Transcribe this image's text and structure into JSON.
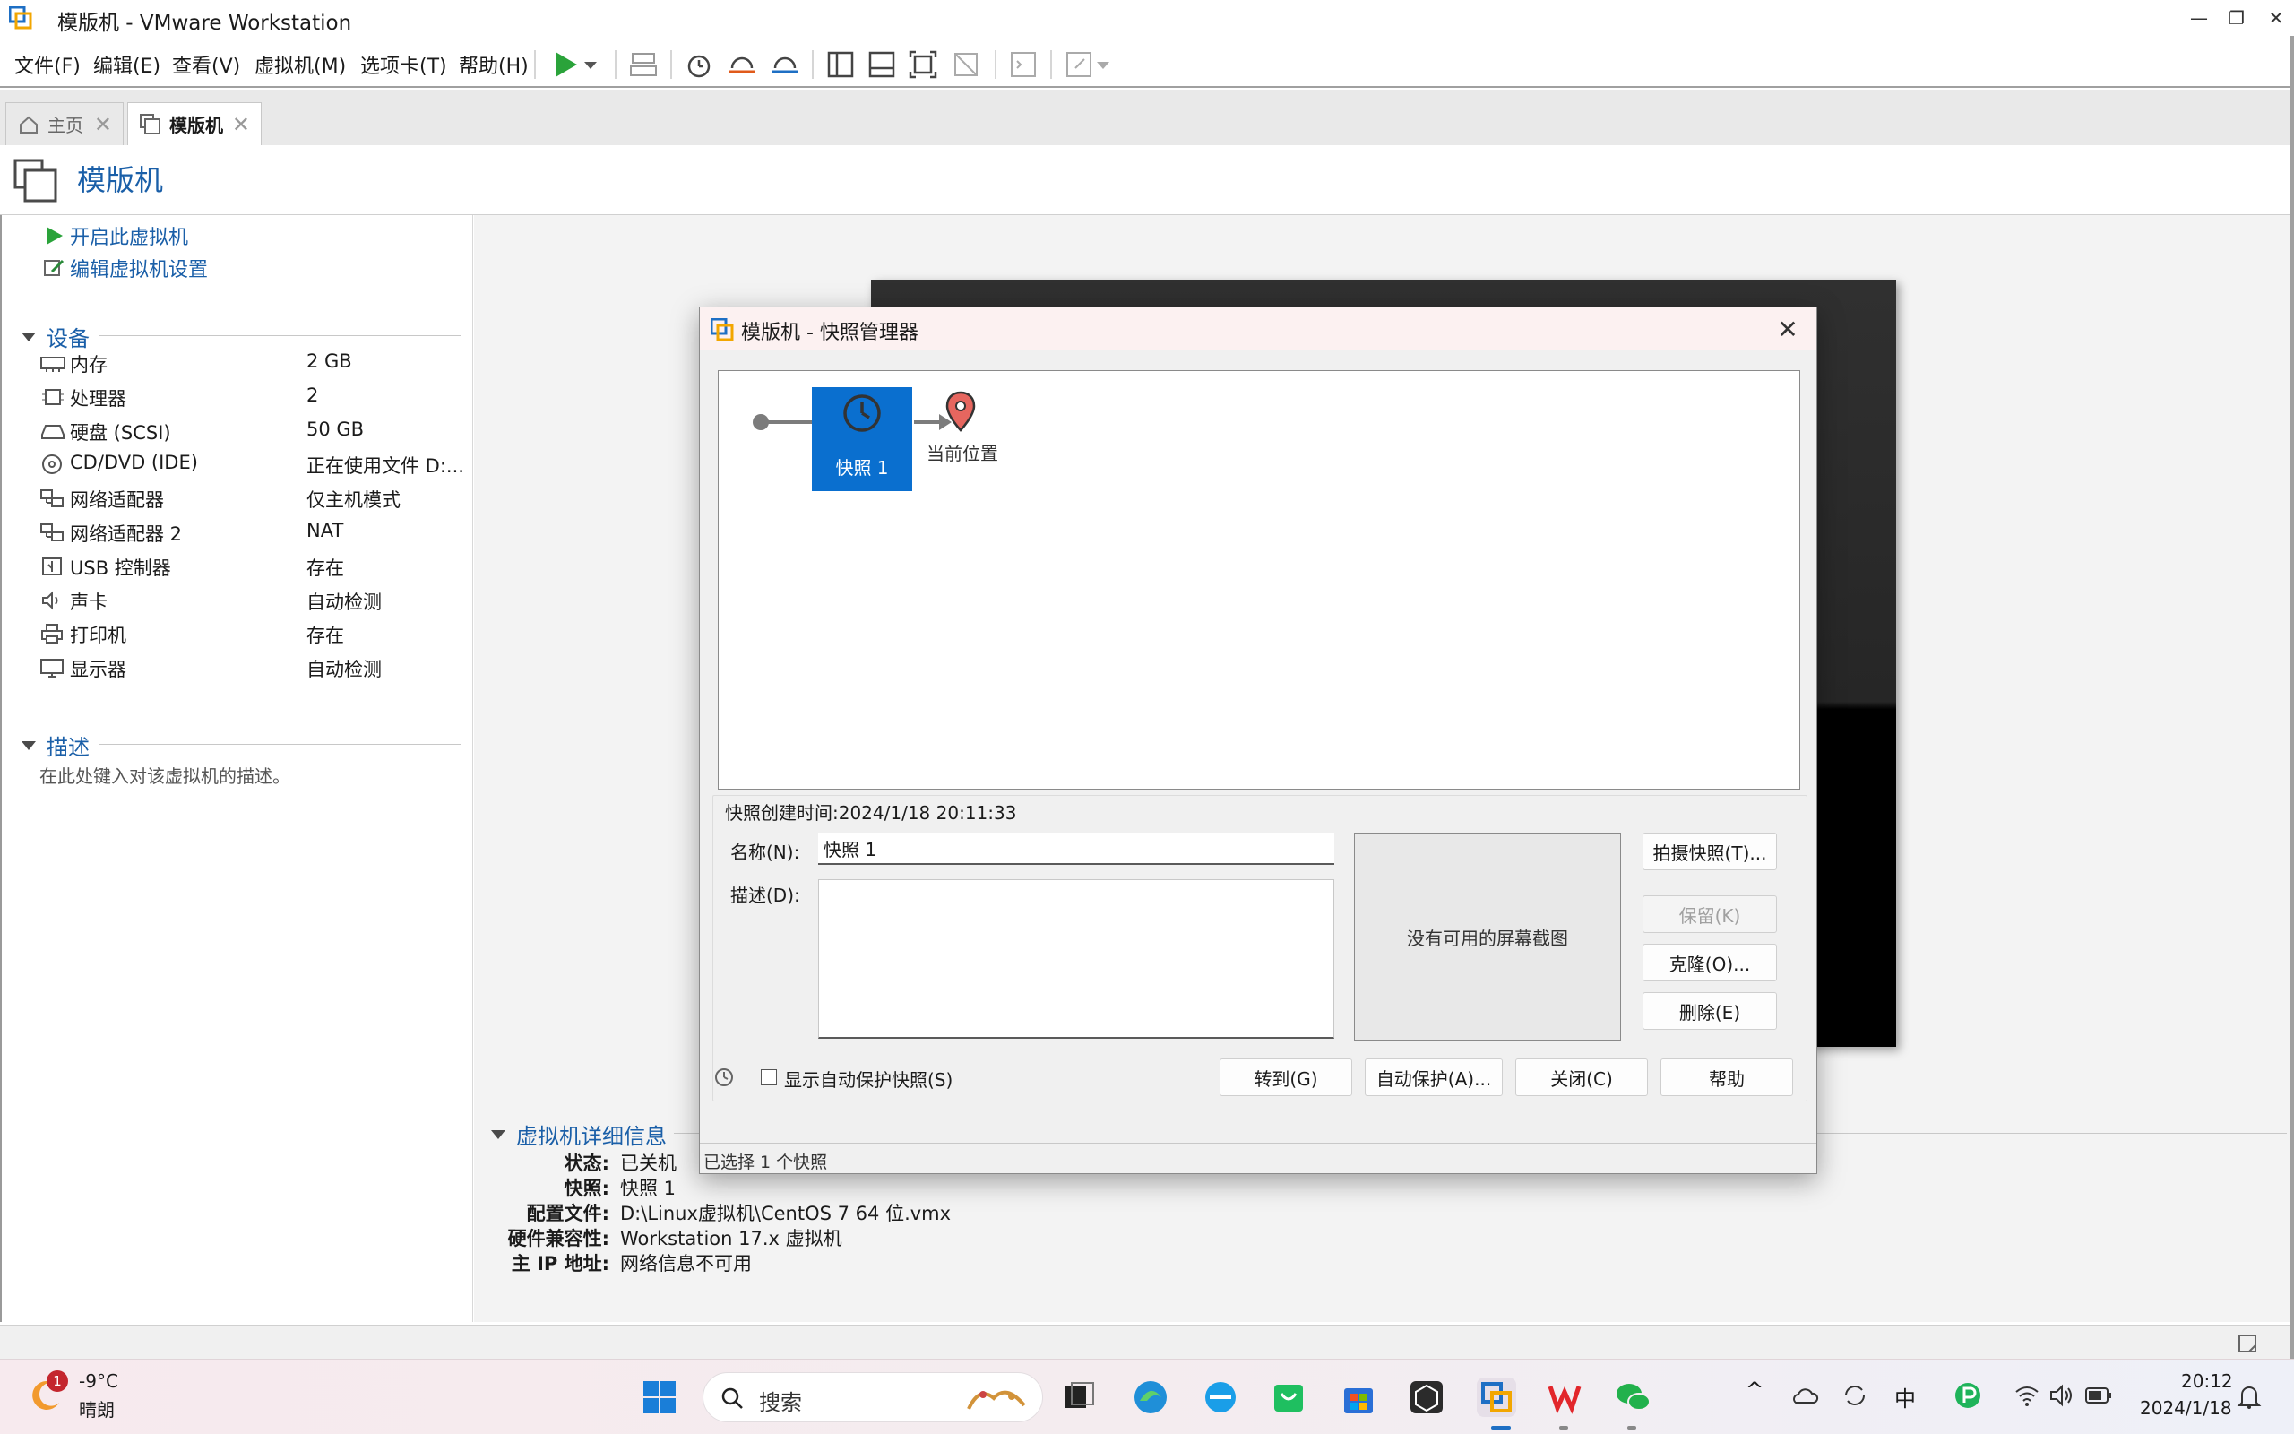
{
  "window": {
    "title": "模版机 - VMware Workstation",
    "minimize": "—",
    "restore": "❐",
    "close": "✕"
  },
  "menu": [
    "文件(F)",
    "编辑(E)",
    "查看(V)",
    "虚拟机(M)",
    "选项卡(T)",
    "帮助(H)"
  ],
  "tabs": [
    {
      "label": "主页",
      "icon": "home-icon"
    },
    {
      "label": "模版机",
      "icon": "vm-icon"
    }
  ],
  "tab_close": "✕",
  "vm": {
    "title": "模版机"
  },
  "actions": {
    "power_on": "开启此虚拟机",
    "edit_settings": "编辑虚拟机设置"
  },
  "devices": {
    "heading": "设备",
    "items": [
      {
        "name": "内存",
        "value": "2 GB",
        "icon": "memory-icon"
      },
      {
        "name": "处理器",
        "value": "2",
        "icon": "cpu-icon"
      },
      {
        "name": "硬盘 (SCSI)",
        "value": "50 GB",
        "icon": "disk-icon"
      },
      {
        "name": "CD/DVD (IDE)",
        "value": "正在使用文件 D:...",
        "icon": "cd-icon"
      },
      {
        "name": "网络适配器",
        "value": "仅主机模式",
        "icon": "network-icon"
      },
      {
        "name": "网络适配器 2",
        "value": "NAT",
        "icon": "network-icon"
      },
      {
        "name": "USB 控制器",
        "value": "存在",
        "icon": "usb-icon"
      },
      {
        "name": "声卡",
        "value": "自动检测",
        "icon": "sound-icon"
      },
      {
        "name": "打印机",
        "value": "存在",
        "icon": "printer-icon"
      },
      {
        "name": "显示器",
        "value": "自动检测",
        "icon": "monitor-icon"
      }
    ]
  },
  "description": {
    "heading": "描述",
    "placeholder": "在此处键入对该虚拟机的描述。"
  },
  "details": {
    "heading": "虚拟机详细信息",
    "rows": [
      {
        "key": "状态:",
        "value": "已关机"
      },
      {
        "key": "快照:",
        "value": "快照 1"
      },
      {
        "key": "配置文件:",
        "value": "D:\\Linux虚拟机\\CentOS 7 64 位.vmx"
      },
      {
        "key": "硬件兼容性:",
        "value": "Workstation 17.x 虚拟机"
      },
      {
        "key": "主 IP 地址:",
        "value": "网络信息不可用"
      }
    ]
  },
  "dialog": {
    "title": "模版机 - 快照管理器",
    "close": "✕",
    "snapshot_node": "快照 1",
    "current_location": "当前位置",
    "created_label": "快照创建时间:2024/1/18 20:11:33",
    "name_label": "名称(N):",
    "name_value": "快照 1",
    "desc_label": "描述(D):",
    "no_screenshot": "没有可用的屏幕截图",
    "buttons": {
      "take": "拍摄快照(T)...",
      "keep": "保留(K)",
      "clone": "克隆(O)...",
      "delete": "删除(E)",
      "goto": "转到(G)",
      "autoprotect": "自动保护(A)...",
      "close": "关闭(C)",
      "help": "帮助"
    },
    "show_autoprotect": "显示自动保护快照(S)",
    "status": "已选择 1 个快照"
  },
  "taskbar": {
    "weather_temp": "-9°C",
    "weather_desc": "晴朗",
    "weather_badge": "1",
    "search_placeholder": "搜索",
    "ime": "中",
    "time": "20:12",
    "date": "2024/1/18",
    "tray_chevron": "^"
  },
  "colors": {
    "accent": "#1a5fa8",
    "snapshot_node": "#0a6fcf",
    "play_green": "#2aa33a"
  }
}
